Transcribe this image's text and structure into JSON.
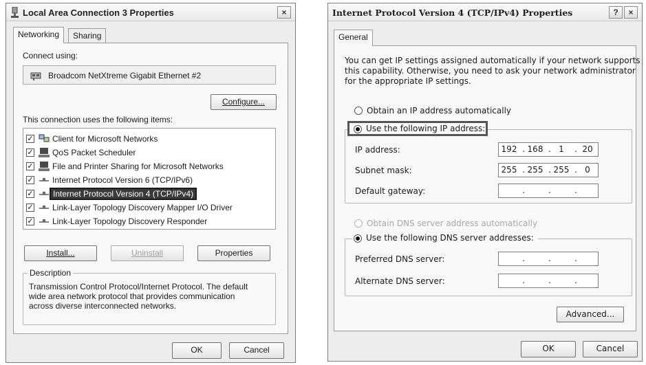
{
  "dialog1": {
    "title": "Local Area Connection 3 Properties",
    "close_glyph": "×",
    "tabs": [
      "Networking",
      "Sharing"
    ],
    "connect_using_label": "Connect using:",
    "adapter_name": "Broadcom NetXtreme Gigabit Ethernet #2",
    "configure_button": "Configure...",
    "items_label": "This connection uses the following items:",
    "items": [
      {
        "label": "Client for Microsoft Networks",
        "checked": true,
        "icon": "network-client-icon"
      },
      {
        "label": "QoS Packet Scheduler",
        "checked": true,
        "icon": "computer-icon"
      },
      {
        "label": "File and Printer Sharing for Microsoft Networks",
        "checked": true,
        "icon": "computer-icon"
      },
      {
        "label": "Internet Protocol Version 6 (TCP/IPv6)",
        "checked": true,
        "icon": "protocol-icon"
      },
      {
        "label": "Internet Protocol Version 4 (TCP/IPv4)",
        "checked": true,
        "icon": "protocol-icon",
        "selected": true
      },
      {
        "label": "Link-Layer Topology Discovery Mapper I/O Driver",
        "checked": true,
        "icon": "protocol-icon"
      },
      {
        "label": "Link-Layer Topology Discovery Responder",
        "checked": true,
        "icon": "protocol-icon"
      }
    ],
    "install_button": "Install...",
    "uninstall_button": "Uninstall",
    "properties_button": "Properties",
    "description_title": "Description",
    "description_lines": [
      "Transmission Control Protocol/Internet Protocol. The default",
      "wide area network protocol that provides communication",
      "across diverse interconnected networks."
    ],
    "ok_button": "OK",
    "cancel_button": "Cancel"
  },
  "dialog2": {
    "title": "Internet Protocol Version 4 (TCP/IPv4) Properties",
    "help_glyph": "?",
    "close_glyph": "×",
    "tab": "General",
    "intro_lines": [
      "You can get IP settings assigned automatically if your network supports",
      "this capability. Otherwise, you need to ask your network administrator",
      "for the appropriate IP settings."
    ],
    "obtain_ip_auto": "Obtain an IP address automatically",
    "use_following_ip": "Use the following IP address:",
    "ip_address_label": "IP address:",
    "ip_address": [
      "192",
      "168",
      "1",
      "20"
    ],
    "subnet_mask_label": "Subnet mask:",
    "subnet_mask": [
      "255",
      "255",
      "255",
      "0"
    ],
    "default_gateway_label": "Default gateway:",
    "default_gateway": [
      "",
      "",
      "",
      ""
    ],
    "obtain_dns_auto": "Obtain DNS server address automatically",
    "use_following_dns": "Use the following DNS server addresses:",
    "preferred_dns_label": "Preferred DNS server:",
    "preferred_dns": [
      "",
      "",
      "",
      ""
    ],
    "alternate_dns_label": "Alternate DNS server:",
    "alternate_dns": [
      "",
      "",
      "",
      ""
    ],
    "advanced_button": "Advanced...",
    "ok_button": "OK",
    "cancel_button": "Cancel"
  }
}
